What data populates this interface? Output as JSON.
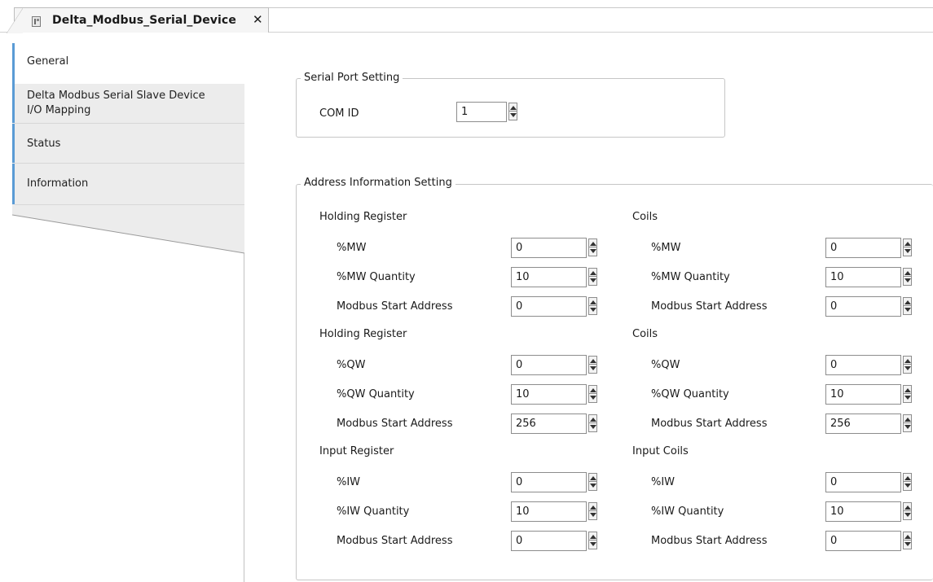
{
  "tab": {
    "title": "Delta_Modbus_Serial_Device",
    "close": "✕"
  },
  "nav": {
    "items": [
      {
        "label": "General"
      },
      {
        "label": "Delta Modbus Serial Slave Device\nI/O Mapping",
        "line1": "Delta Modbus Serial Slave Device",
        "line2": "I/O Mapping"
      },
      {
        "label": "Status"
      },
      {
        "label": "Information"
      }
    ]
  },
  "serial": {
    "legend": "Serial Port Setting",
    "com_label": "COM ID",
    "com_value": "1"
  },
  "address": {
    "legend": "Address Information Setting",
    "left": [
      {
        "heading": "Holding Register",
        "rows": [
          {
            "label": "%MW",
            "value": "0"
          },
          {
            "label": "%MW Quantity",
            "value": "10"
          },
          {
            "label": "Modbus Start Address",
            "value": "0"
          }
        ]
      },
      {
        "heading": "Holding Register",
        "rows": [
          {
            "label": "%QW",
            "value": "0"
          },
          {
            "label": "%QW Quantity",
            "value": "10"
          },
          {
            "label": "Modbus Start Address",
            "value": "256"
          }
        ]
      },
      {
        "heading": "Input Register",
        "rows": [
          {
            "label": "%IW",
            "value": "0"
          },
          {
            "label": "%IW Quantity",
            "value": "10"
          },
          {
            "label": "Modbus Start Address",
            "value": "0"
          }
        ]
      }
    ],
    "right": [
      {
        "heading": "Coils",
        "rows": [
          {
            "label": "%MW",
            "value": "0"
          },
          {
            "label": "%MW Quantity",
            "value": "10"
          },
          {
            "label": "Modbus Start Address",
            "value": "0"
          }
        ]
      },
      {
        "heading": "Coils",
        "rows": [
          {
            "label": "%QW",
            "value": "0"
          },
          {
            "label": "%QW Quantity",
            "value": "10"
          },
          {
            "label": "Modbus Start Address",
            "value": "256"
          }
        ]
      },
      {
        "heading": "Input Coils",
        "rows": [
          {
            "label": "%IW",
            "value": "0"
          },
          {
            "label": "%IW Quantity",
            "value": "10"
          },
          {
            "label": "Modbus Start Address",
            "value": "0"
          }
        ]
      }
    ]
  },
  "colors": {
    "accent": "#5a9bd5",
    "nav_bg": "#ececec",
    "border": "#c6c6c6"
  }
}
